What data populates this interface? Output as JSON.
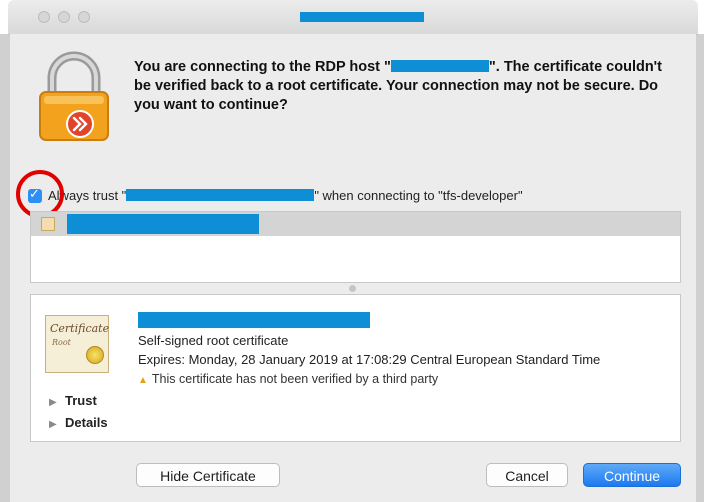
{
  "window": {
    "title_redacted": true
  },
  "message": {
    "part1": "You are connecting to the RDP host \"",
    "part2": "\". The certificate couldn't be verified back to a root certificate. Your connection may not be secure. Do you want to continue?"
  },
  "trust_option": {
    "checked": true,
    "label_prefix": "Always trust \"",
    "label_suffix": "\" when connecting to \"tfs-developer\""
  },
  "certificate_list": {
    "items": [
      {
        "name_redacted": true,
        "selected": true
      }
    ]
  },
  "certificate_detail": {
    "icon_label_main": "Certificate",
    "icon_label_sub": "Root",
    "type": "Self-signed root certificate",
    "expires": "Expires: Monday, 28 January 2019 at 17:08:29 Central European Standard Time",
    "warning_icon": "warning-triangle-icon",
    "warning": "This certificate has not been verified by a third party",
    "sections": [
      {
        "label": "Trust"
      },
      {
        "label": "Details"
      }
    ]
  },
  "buttons": {
    "hide_certificate": "Hide Certificate",
    "cancel": "Cancel",
    "continue": "Continue"
  },
  "colors": {
    "redaction": "#0e8ed4",
    "primary_button": "#1c79f0",
    "annotation_circle": "#e00000",
    "checkbox": "#2d8ef5"
  }
}
